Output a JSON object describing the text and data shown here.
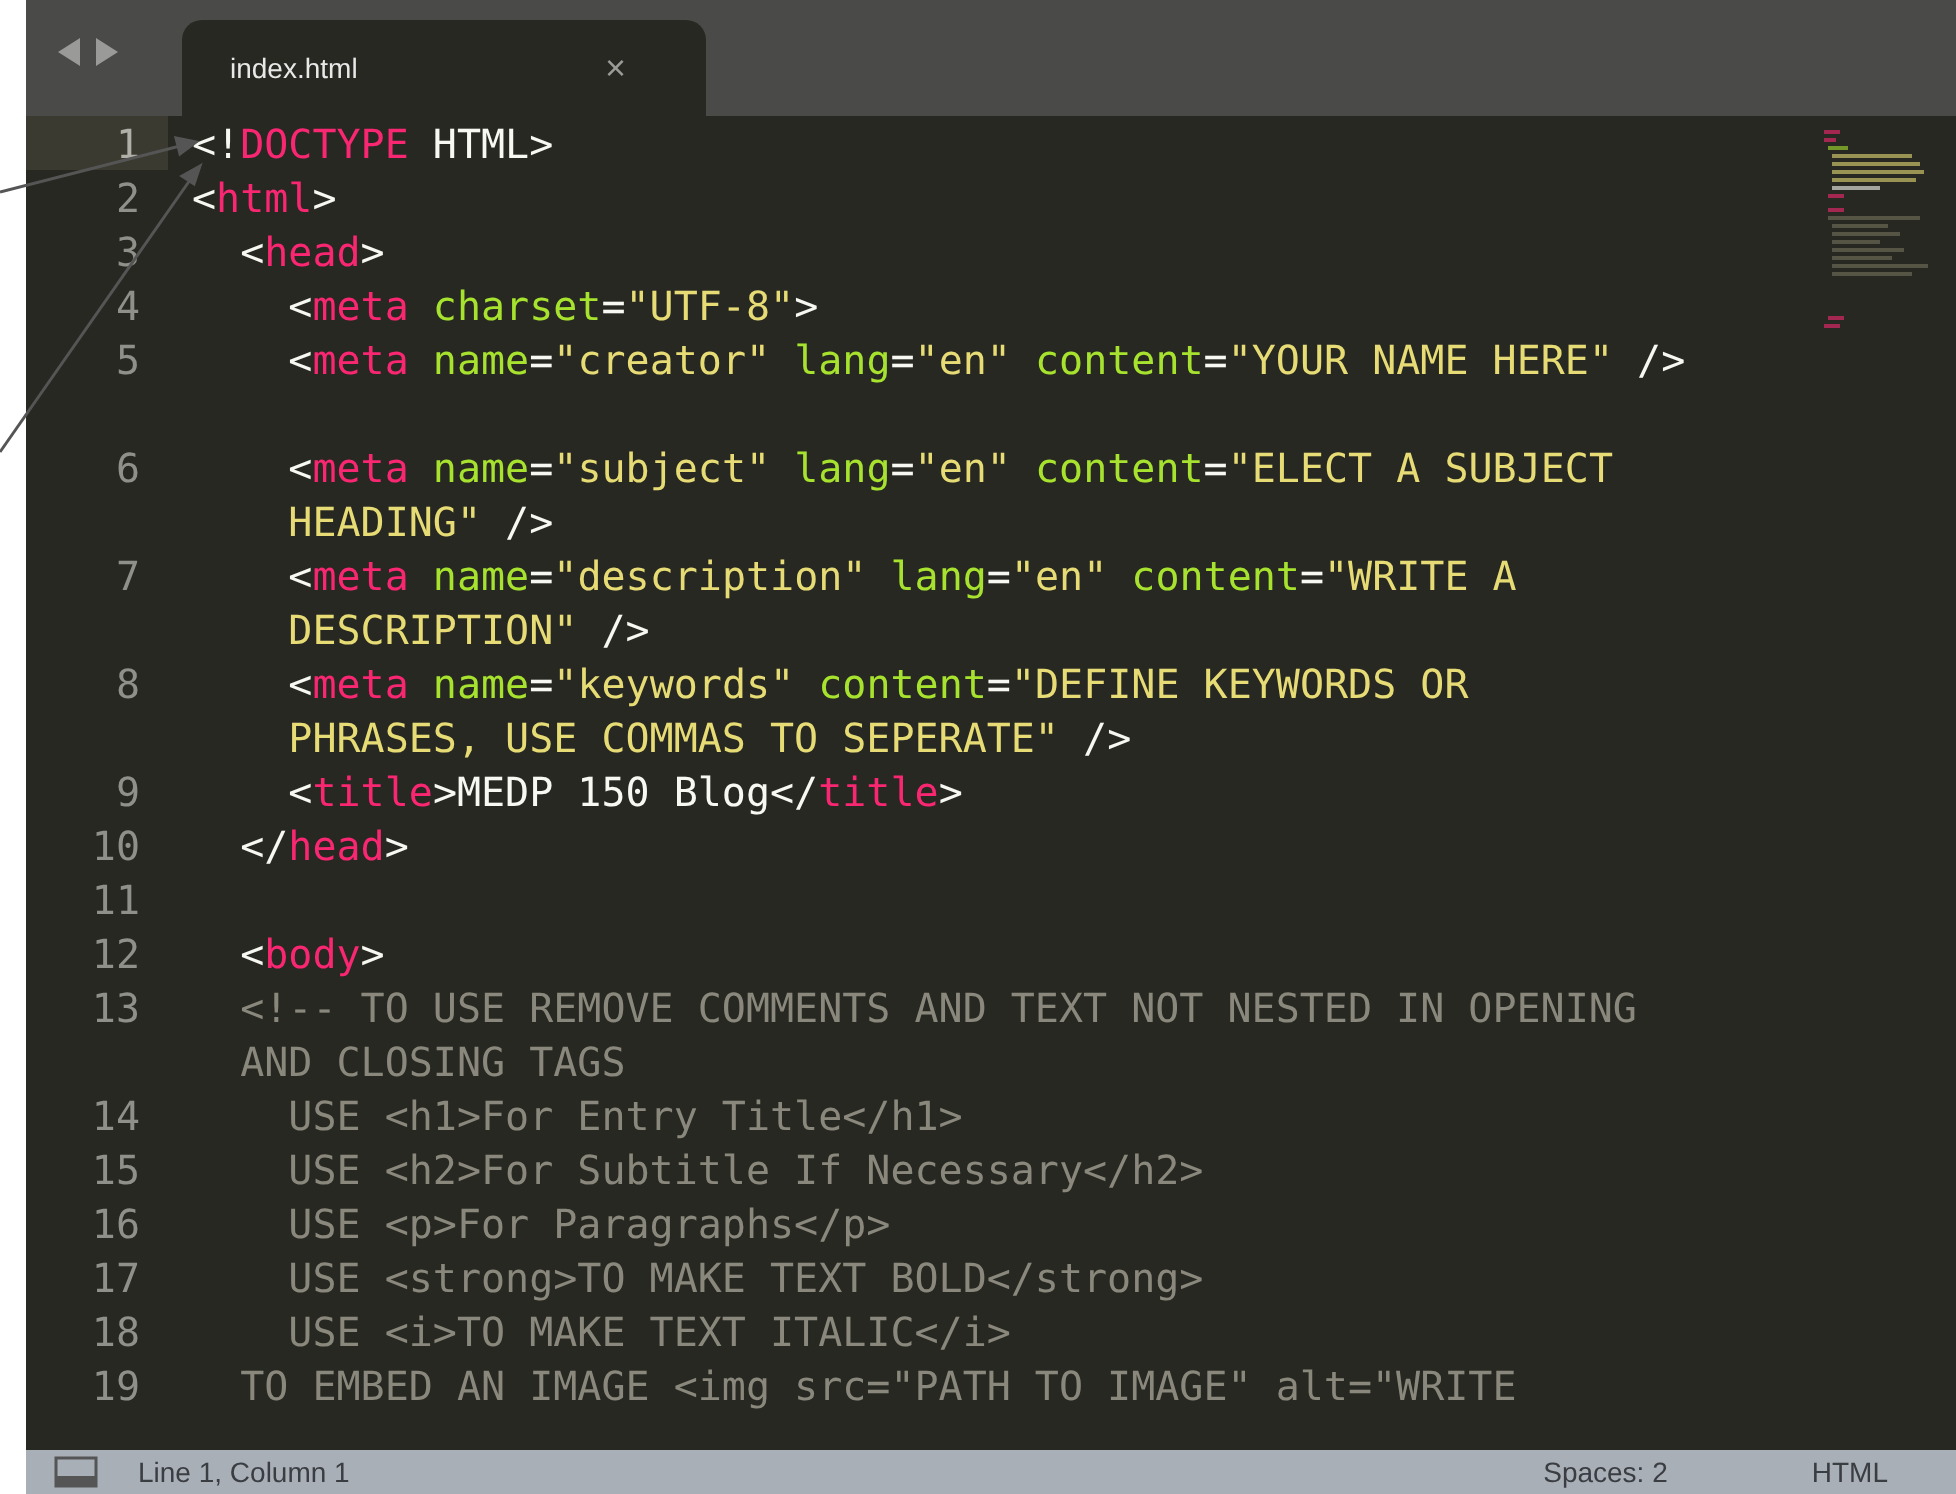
{
  "tab_bar": {
    "tabs": [
      {
        "label": "index.html",
        "close": "×",
        "selected": true
      }
    ]
  },
  "editor": {
    "lines": [
      {
        "number": "1",
        "current": true,
        "segments": [
          {
            "kind": "punct",
            "text": "<!"
          },
          {
            "kind": "tag",
            "text": "DOCTYPE"
          },
          {
            "kind": "punct",
            "text": " HTML>"
          }
        ]
      },
      {
        "number": "2",
        "current": false,
        "segments": [
          {
            "kind": "punct",
            "text": "<"
          },
          {
            "kind": "tag",
            "text": "html"
          },
          {
            "kind": "punct",
            "text": ">"
          }
        ]
      },
      {
        "number": "3",
        "current": false,
        "segments": [
          {
            "kind": "punct",
            "text": "  <"
          },
          {
            "kind": "tag",
            "text": "head"
          },
          {
            "kind": "punct",
            "text": ">"
          }
        ]
      },
      {
        "number": "4",
        "current": false,
        "segments": [
          {
            "kind": "punct",
            "text": "    <"
          },
          {
            "kind": "tag",
            "text": "meta"
          },
          {
            "kind": "attr",
            "text": " charset"
          },
          {
            "kind": "punct",
            "text": "="
          },
          {
            "kind": "string",
            "text": "\"UTF-8\""
          },
          {
            "kind": "punct",
            "text": ">"
          }
        ]
      },
      {
        "number": "5",
        "current": false,
        "blank_row_after": true,
        "segments": [
          {
            "kind": "punct",
            "text": "    <"
          },
          {
            "kind": "tag",
            "text": "meta"
          },
          {
            "kind": "attr",
            "text": " name"
          },
          {
            "kind": "punct",
            "text": "="
          },
          {
            "kind": "string",
            "text": "\"creator\""
          },
          {
            "kind": "attr",
            "text": " lang"
          },
          {
            "kind": "punct",
            "text": "="
          },
          {
            "kind": "string",
            "text": "\"en\""
          },
          {
            "kind": "attr",
            "text": " content"
          },
          {
            "kind": "punct",
            "text": "="
          },
          {
            "kind": "string",
            "text": "\"YOUR NAME HERE\""
          },
          {
            "kind": "punct",
            "text": " />"
          }
        ]
      },
      {
        "number": "6",
        "current": false,
        "segments": [
          {
            "kind": "punct",
            "text": "    <"
          },
          {
            "kind": "tag",
            "text": "meta"
          },
          {
            "kind": "attr",
            "text": " name"
          },
          {
            "kind": "punct",
            "text": "="
          },
          {
            "kind": "string",
            "text": "\"subject\""
          },
          {
            "kind": "attr",
            "text": " lang"
          },
          {
            "kind": "punct",
            "text": "="
          },
          {
            "kind": "string",
            "text": "\"en\""
          },
          {
            "kind": "attr",
            "text": " content"
          },
          {
            "kind": "punct",
            "text": "="
          },
          {
            "kind": "string",
            "text": "\"ELECT A SUBJECT"
          },
          {
            "kind": "string",
            "wrap": true,
            "text": "    HEADING\""
          },
          {
            "kind": "punct",
            "text": " />"
          }
        ]
      },
      {
        "number": "7",
        "current": false,
        "segments": [
          {
            "kind": "punct",
            "text": "    <"
          },
          {
            "kind": "tag",
            "text": "meta"
          },
          {
            "kind": "attr",
            "text": " name"
          },
          {
            "kind": "punct",
            "text": "="
          },
          {
            "kind": "string",
            "text": "\"description\""
          },
          {
            "kind": "attr",
            "text": " lang"
          },
          {
            "kind": "punct",
            "text": "="
          },
          {
            "kind": "string",
            "text": "\"en\""
          },
          {
            "kind": "attr",
            "text": " content"
          },
          {
            "kind": "punct",
            "text": "="
          },
          {
            "kind": "string",
            "text": "\"WRITE A"
          },
          {
            "kind": "string",
            "wrap": true,
            "text": "    DESCRIPTION\""
          },
          {
            "kind": "punct",
            "text": " />"
          }
        ]
      },
      {
        "number": "8",
        "current": false,
        "segments": [
          {
            "kind": "punct",
            "text": "    <"
          },
          {
            "kind": "tag",
            "text": "meta"
          },
          {
            "kind": "attr",
            "text": " name"
          },
          {
            "kind": "punct",
            "text": "="
          },
          {
            "kind": "string",
            "text": "\"keywords\""
          },
          {
            "kind": "attr",
            "text": " content"
          },
          {
            "kind": "punct",
            "text": "="
          },
          {
            "kind": "string",
            "text": "\"DEFINE KEYWORDS OR"
          },
          {
            "kind": "string",
            "wrap": true,
            "text": "    PHRASES, USE COMMAS TO SEPERATE\""
          },
          {
            "kind": "punct",
            "text": " />"
          }
        ]
      },
      {
        "number": "9",
        "current": false,
        "segments": [
          {
            "kind": "punct",
            "text": "    <"
          },
          {
            "kind": "tag",
            "text": "title"
          },
          {
            "kind": "punct",
            "text": ">MEDP 150 Blog</"
          },
          {
            "kind": "tag",
            "text": "title"
          },
          {
            "kind": "punct",
            "text": ">"
          }
        ]
      },
      {
        "number": "10",
        "current": false,
        "segments": [
          {
            "kind": "punct",
            "text": "  </"
          },
          {
            "kind": "tag",
            "text": "head"
          },
          {
            "kind": "punct",
            "text": ">"
          }
        ]
      },
      {
        "number": "11",
        "current": false
      },
      {
        "number": "12",
        "current": false,
        "segments": [
          {
            "kind": "punct",
            "text": "  <"
          },
          {
            "kind": "tag",
            "text": "body"
          },
          {
            "kind": "punct",
            "text": ">"
          }
        ]
      },
      {
        "number": "13",
        "current": false,
        "segments": [
          {
            "kind": "comment",
            "text": "  <!-- TO USE REMOVE COMMENTS AND TEXT NOT NESTED IN OPENING"
          },
          {
            "kind": "comment",
            "wrap": true,
            "text": "  AND CLOSING TAGS"
          }
        ]
      },
      {
        "number": "14",
        "current": false,
        "segments": [
          {
            "kind": "comment",
            "text": "    USE <h1>For Entry Title</h1>"
          }
        ]
      },
      {
        "number": "15",
        "current": false,
        "segments": [
          {
            "kind": "comment",
            "text": "    USE <h2>For Subtitle If Necessary</h2>"
          }
        ]
      },
      {
        "number": "16",
        "current": false,
        "segments": [
          {
            "kind": "comment",
            "text": "    USE <p>For Paragraphs</p>"
          }
        ]
      },
      {
        "number": "17",
        "current": false,
        "segments": [
          {
            "kind": "comment",
            "text": "    USE <strong>TO MAKE TEXT BOLD</strong>"
          }
        ]
      },
      {
        "number": "18",
        "current": false,
        "segments": [
          {
            "kind": "comment",
            "text": "    USE <i>TO MAKE TEXT ITALIC</i>"
          }
        ]
      },
      {
        "number": "19",
        "current": false,
        "segments": [
          {
            "kind": "comment",
            "text": "  TO EMBED AN IMAGE <img src=\"PATH TO IMAGE\" alt=\"WRITE"
          }
        ]
      }
    ]
  },
  "status_bar": {
    "position": "Line 1, Column 1",
    "indentation": "Spaces: 2",
    "syntax": "HTML"
  }
}
